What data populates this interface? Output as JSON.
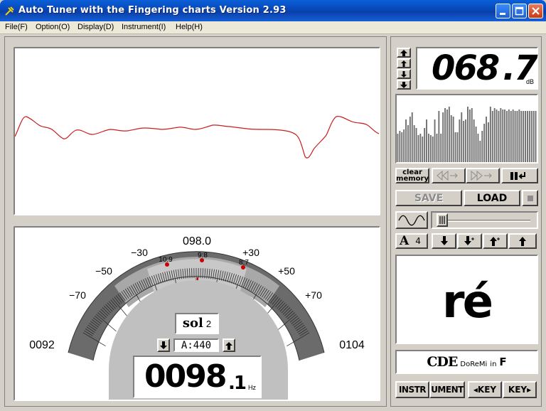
{
  "window": {
    "title": "Auto Tuner with the Fingering charts  Version 2.93"
  },
  "menu": {
    "items": [
      "File(F)",
      "Option(O)",
      "Display(D)",
      "Instrument(I)",
      "Help(H)"
    ]
  },
  "meter": {
    "frequency_center": "098.0",
    "scale_left": [
      "−30",
      "−50",
      "−70"
    ],
    "scale_right": [
      "+30",
      "+50",
      "+70"
    ],
    "range_min": "0092",
    "range_max": "0104",
    "marker_labels": [
      "10:9",
      "9:8",
      "8:7"
    ],
    "note_name": "sol",
    "note_octave": "2",
    "reference_label": "A:440",
    "frequency_int": "0098",
    "frequency_dec": ".1",
    "frequency_unit": "Hz"
  },
  "level": {
    "value_int": "068",
    "value_dec": ".7",
    "unit": "dB"
  },
  "controls": {
    "clear_memory_line1": "clear",
    "clear_memory_line2": "memory",
    "save_label": "SAVE",
    "load_label": "LOAD",
    "transpose_note": "A",
    "transpose_num": "4"
  },
  "fingering": {
    "note_syllable": "ré",
    "notation_big": "CDE",
    "notation_small": "DoReMi",
    "notation_in": "in",
    "notation_key": "F"
  },
  "bottom_buttons": {
    "instr_label": "INSTR",
    "ument_label": "UMENT",
    "key_down_label": "◂KEY",
    "key_up_label": "KEY▸"
  },
  "colors": {
    "waveform": "#c81e1e",
    "needle": "#cc0000",
    "titlebar": "#0a53d0"
  }
}
